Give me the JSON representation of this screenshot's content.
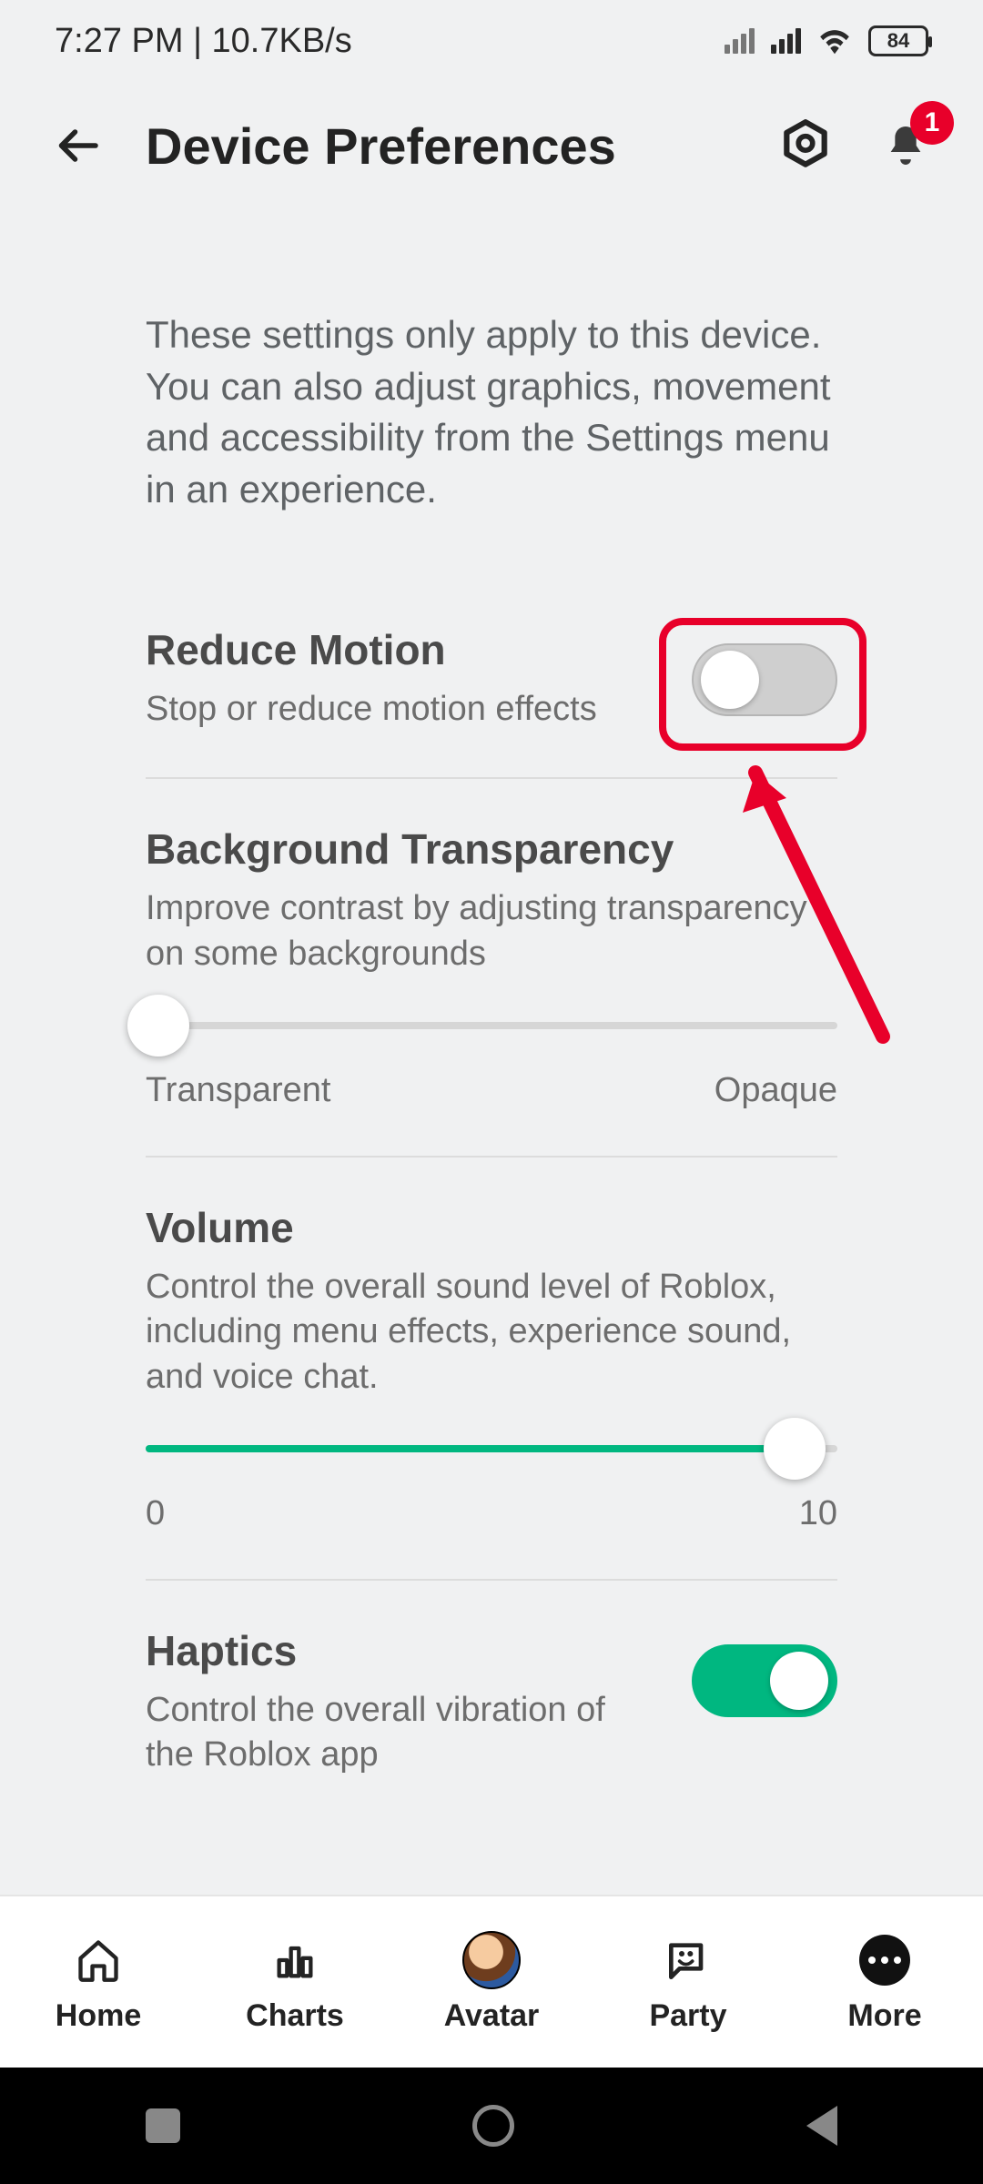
{
  "status": {
    "time": "7:27 PM",
    "net_speed": "10.7KB/s",
    "battery": "84"
  },
  "header": {
    "title": "Device Preferences",
    "notification_count": "1"
  },
  "intro": "These settings only apply to this device. You can also adjust graphics, movement and accessibility from the Settings menu in an experience.",
  "reduce_motion": {
    "title": "Reduce Motion",
    "desc": "Stop or reduce motion effects",
    "enabled": false
  },
  "bg_transparency": {
    "title": "Background Transparency",
    "desc": "Improve contrast by adjusting transparency on some backgrounds",
    "min_label": "Transparent",
    "max_label": "Opaque",
    "value_pct": 0
  },
  "volume": {
    "title": "Volume",
    "desc": "Control the overall sound level of Roblox, including menu effects, experience sound, and voice chat.",
    "min_label": "0",
    "max_label": "10",
    "value_pct": 92
  },
  "haptics": {
    "title": "Haptics",
    "desc": "Control the overall vibration of the Roblox app",
    "enabled": true
  },
  "nav": {
    "home": "Home",
    "charts": "Charts",
    "avatar": "Avatar",
    "party": "Party",
    "more": "More"
  },
  "annotation": {
    "highlight_color": "#e8002a"
  }
}
